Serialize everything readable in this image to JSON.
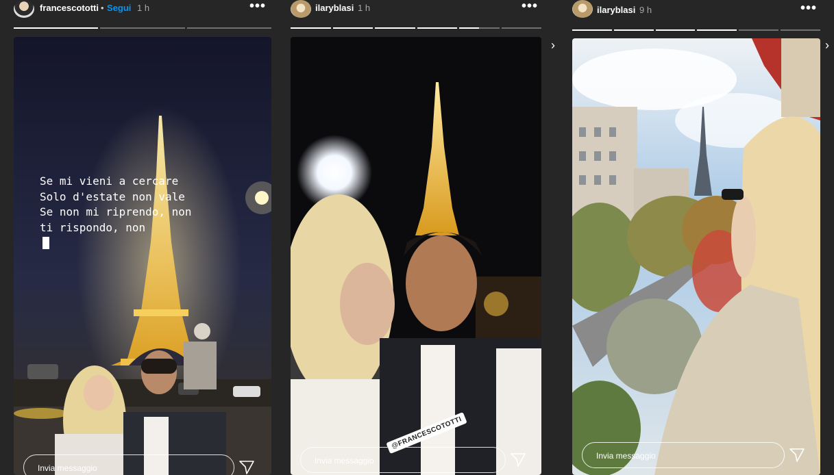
{
  "stories": [
    {
      "username": "francescototti",
      "separator": "•",
      "follow_label": "Segui",
      "time": "1 h",
      "more_icon": "more-horizontal-icon",
      "progress": [
        1,
        0,
        0
      ],
      "lyrics": "Se mi vieni a cercare\nSolo d'estate non vale\nSe non mi riprendo, non\nti rispondo, non",
      "message_placeholder": "Invia messaggio",
      "send_icon": "send-icon"
    },
    {
      "username": "ilaryblasi",
      "time": "1 h",
      "more_icon": "more-horizontal-icon",
      "progress": [
        1,
        1,
        1,
        1,
        0.5,
        0
      ],
      "mention_sticker": "@FRANCESCOTOTTI",
      "message_placeholder": "Invia messaggio",
      "send_icon": "send-icon"
    },
    {
      "username": "ilaryblasi",
      "time": "9 h",
      "more_icon": "more-horizontal-icon",
      "progress": [
        1,
        1,
        1,
        1,
        0,
        0
      ],
      "message_placeholder": "Invia messaggio",
      "send_icon": "send-icon"
    }
  ],
  "colors": {
    "background": "#262626",
    "follow": "#0095f6",
    "text": "#ffffff"
  },
  "navigation": {
    "next_icon": "chevron-right-icon"
  }
}
